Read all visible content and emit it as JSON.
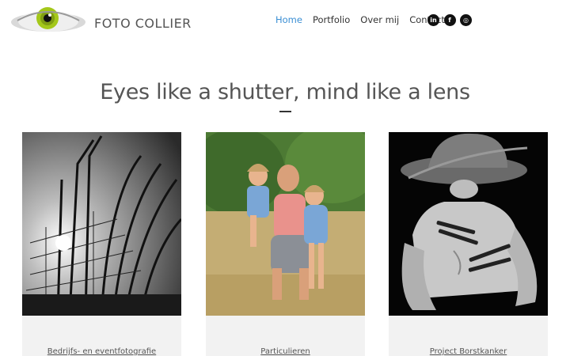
{
  "header": {
    "brand": "FOTO COLLIER",
    "nav": [
      "Home",
      "Portfolio",
      "Over mij",
      "Contact"
    ],
    "active": "Home",
    "social": [
      {
        "icon": "linkedin-icon",
        "glyph": "in"
      },
      {
        "icon": "facebook-icon",
        "glyph": "f"
      },
      {
        "icon": "instagram-icon",
        "glyph": "◎"
      }
    ]
  },
  "hero": {
    "title": "Eyes like a shutter, mind like a lens"
  },
  "cards": [
    {
      "caption": "Bedrijfs- en eventfotografie"
    },
    {
      "caption": "Particulieren"
    },
    {
      "caption": "Project Borstkanker"
    }
  ],
  "colors": {
    "accent": "#3b8fd4",
    "card_bg": "#f2f2f2",
    "eye_iris": "#a4c81a"
  }
}
